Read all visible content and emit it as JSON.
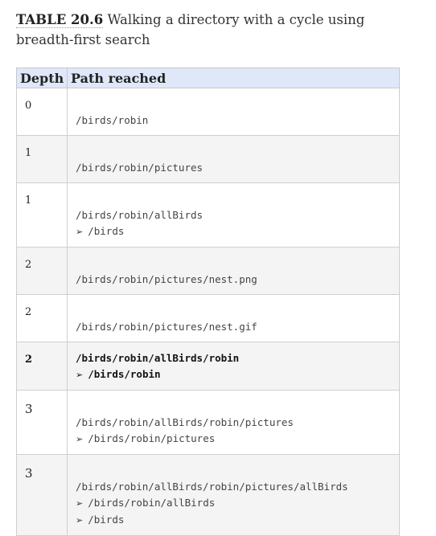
{
  "caption": {
    "tag": "TABLE 20.6",
    "text": " Walking a directory with a cycle using breadth-first search"
  },
  "table": {
    "headers": [
      "Depth",
      "Path reached"
    ],
    "rows": [
      {
        "depth": "0",
        "path": "/birds/robin",
        "links": [],
        "bold": false
      },
      {
        "depth": "1",
        "path": "/birds/robin/pictures",
        "links": [],
        "bold": false
      },
      {
        "depth": "1",
        "path": "/birds/robin/allBirds",
        "links": [
          "/birds"
        ],
        "bold": false
      },
      {
        "depth": "2",
        "path": "/birds/robin/pictures/nest.png",
        "links": [],
        "bold": false
      },
      {
        "depth": "2",
        "path": "/birds/robin/pictures/nest.gif",
        "links": [],
        "bold": false
      },
      {
        "depth": "2",
        "path": "/birds/robin/allBirds/robin",
        "links": [
          "/birds/robin"
        ],
        "bold": true
      },
      {
        "depth": "3",
        "path": "/birds/robin/allBirds/robin/pictures",
        "links": [
          "/birds/robin/pictures"
        ],
        "bold": false
      },
      {
        "depth": "3",
        "path": "/birds/robin/allBirds/robin/pictures/allBirds",
        "links": [
          "/birds/robin/allBirds",
          "/birds"
        ],
        "bold": false
      }
    ],
    "link_arrow": "➢"
  }
}
